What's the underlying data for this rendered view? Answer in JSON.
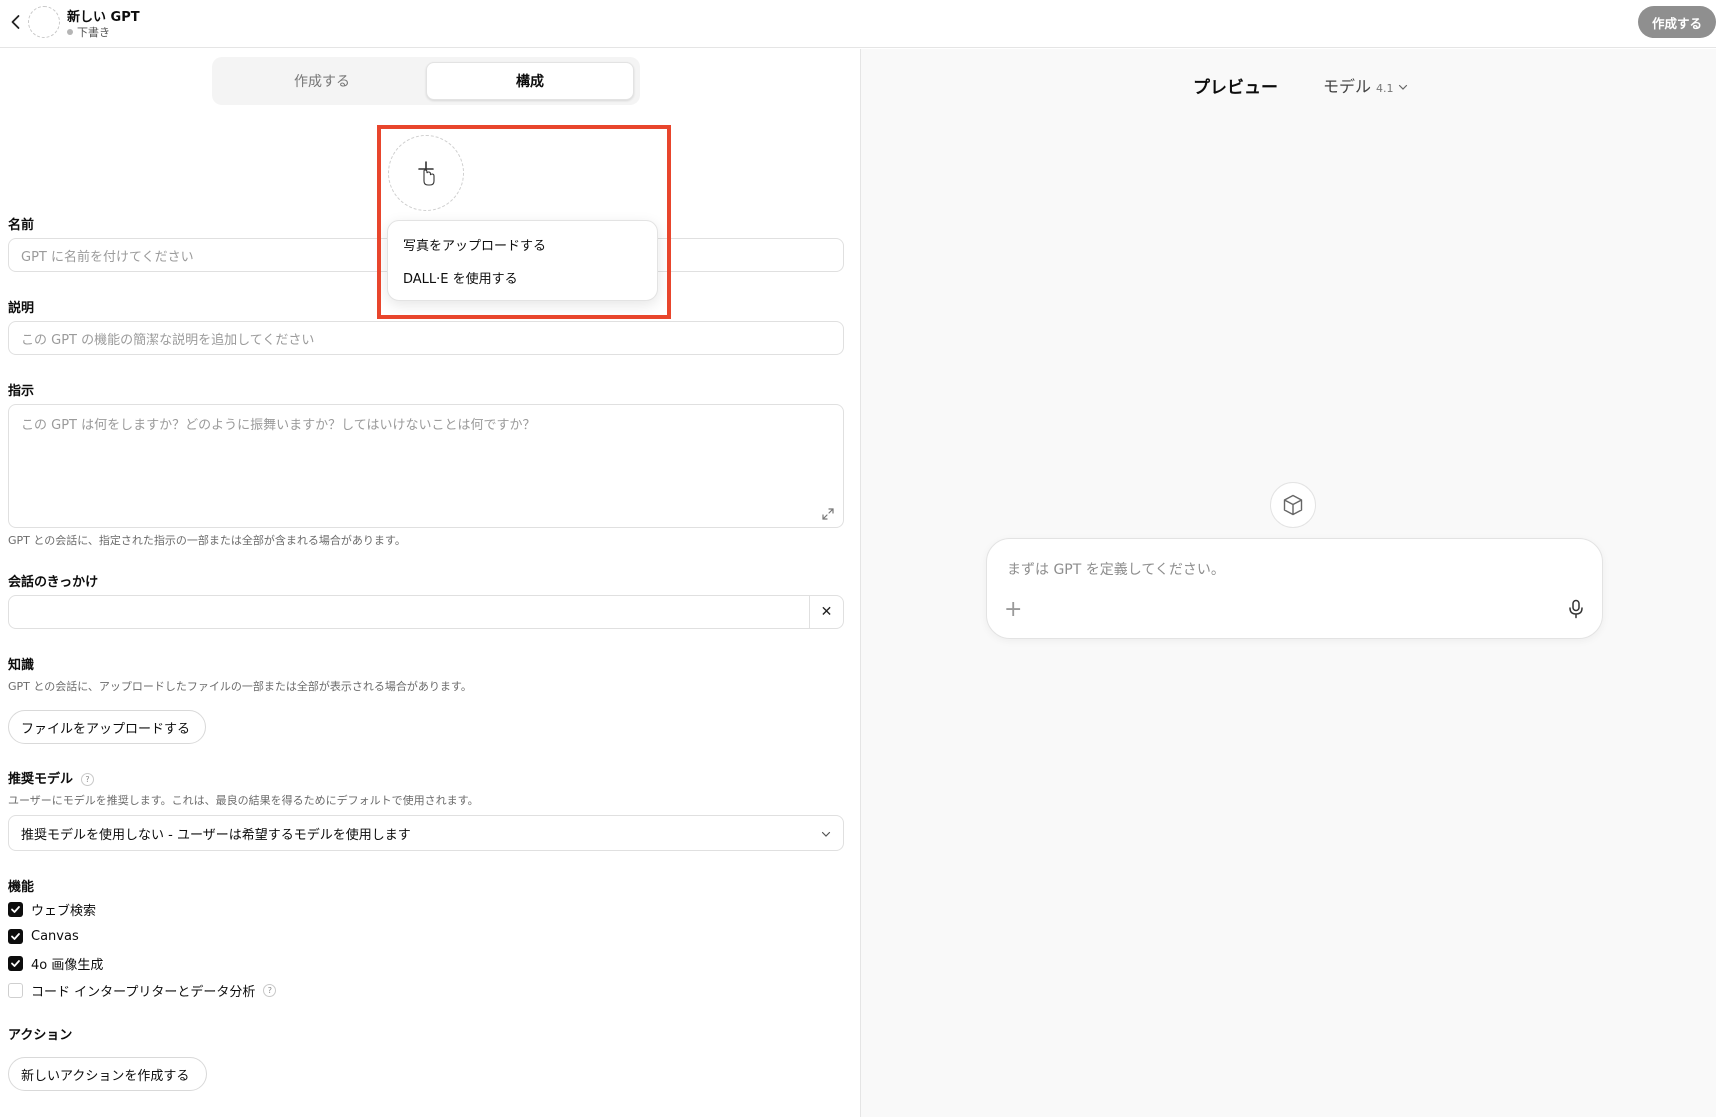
{
  "header": {
    "title": "新しい GPT",
    "status": "下書き",
    "create_button": "作成する"
  },
  "tabs": {
    "create": "作成する",
    "configure": "構成"
  },
  "avatar_menu": {
    "upload_photo": "写真をアップロードする",
    "use_dalle": "DALL·E を使用する"
  },
  "form": {
    "name_label": "名前",
    "name_placeholder": "GPT に名前を付けてください",
    "description_label": "説明",
    "description_placeholder": "この GPT の機能の簡潔な説明を追加してください",
    "instructions_label": "指示",
    "instructions_placeholder": "この GPT は何をしますか？どのように振舞いますか？してはいけないことは何ですか？",
    "instructions_help": "GPT との会話に、指定された指示の一部または全部が含まれる場合があります。",
    "starters_label": "会話のきっかけ",
    "starters_clear": "✕",
    "knowledge_label": "知識",
    "knowledge_help": "GPT との会話に、アップロードしたファイルの一部または全部が表示される場合があります。",
    "upload_files_button": "ファイルをアップロードする",
    "recommended_model_label": "推奨モデル",
    "recommended_model_help": "ユーザーにモデルを推奨します。これは、最良の結果を得るためにデフォルトで使用されます。",
    "recommended_model_value": "推奨モデルを使用しない - ユーザーは希望するモデルを使用します",
    "capabilities_label": "機能",
    "capabilities": [
      {
        "label": "ウェブ検索",
        "checked": true
      },
      {
        "label": "Canvas",
        "checked": true
      },
      {
        "label": "4o 画像生成",
        "checked": true
      },
      {
        "label": "コード インタープリターとデータ分析",
        "checked": false
      }
    ],
    "actions_label": "アクション",
    "new_action_button": "新しいアクションを作成する",
    "info_glyph": "?"
  },
  "preview": {
    "title": "プレビュー",
    "model_label": "モデル",
    "model_version": "4.1",
    "composer_placeholder": "まずは GPT を定義してください。",
    "composer_plus": "+"
  },
  "icons": {
    "back": "chevron-left-icon",
    "avatar_add": "plus-icon",
    "expand": "expand-icon",
    "clear": "close-icon",
    "select": "chevron-down-icon",
    "info": "info-icon",
    "cube": "cube-icon",
    "mic": "microphone-icon"
  },
  "colors": {
    "highlight": "#e8452c",
    "create_button_bg": "#8f8f8f",
    "checkbox_on": "#0d0d0d"
  }
}
